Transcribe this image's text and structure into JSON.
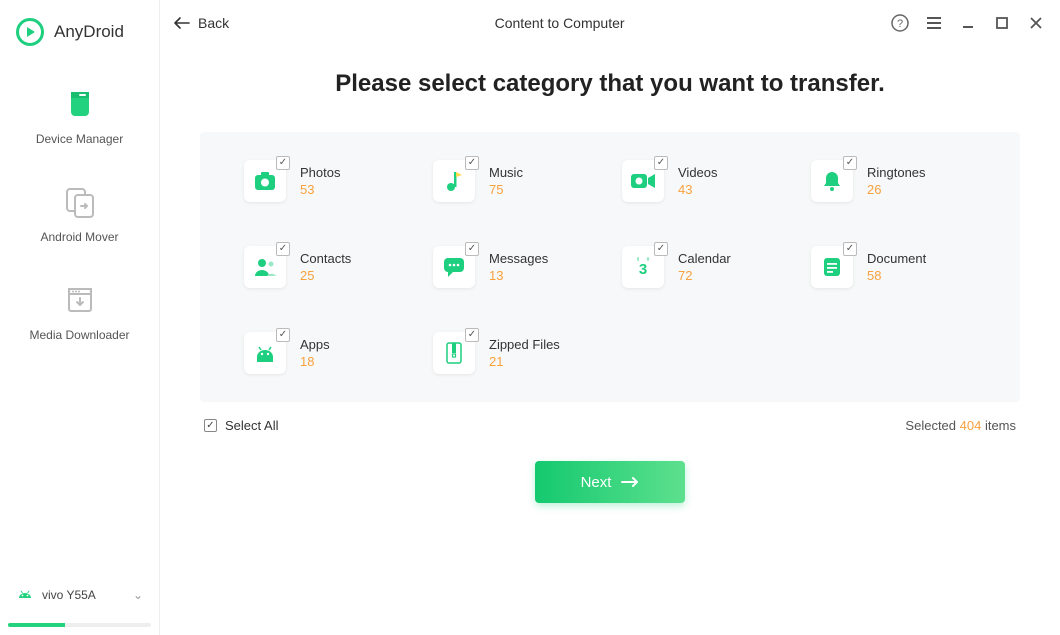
{
  "app": {
    "name": "AnyDroid"
  },
  "titlebar": {
    "back": "Back",
    "title": "Content to Computer"
  },
  "sidebar": {
    "items": [
      {
        "label": "Device Manager"
      },
      {
        "label": "Android Mover"
      },
      {
        "label": "Media Downloader"
      }
    ],
    "device": {
      "name": "vivo Y55A"
    }
  },
  "heading": "Please select category that you want to transfer.",
  "categories": [
    {
      "name": "Photos",
      "count": "53"
    },
    {
      "name": "Music",
      "count": "75"
    },
    {
      "name": "Videos",
      "count": "43"
    },
    {
      "name": "Ringtones",
      "count": "26"
    },
    {
      "name": "Contacts",
      "count": "25"
    },
    {
      "name": "Messages",
      "count": "13"
    },
    {
      "name": "Calendar",
      "count": "72"
    },
    {
      "name": "Document",
      "count": "58"
    },
    {
      "name": "Apps",
      "count": "18"
    },
    {
      "name": "Zipped Files",
      "count": "21"
    }
  ],
  "selectAll": "Select All",
  "summary": {
    "prefix": "Selected ",
    "count": "404",
    "suffix": " items"
  },
  "next": "Next"
}
